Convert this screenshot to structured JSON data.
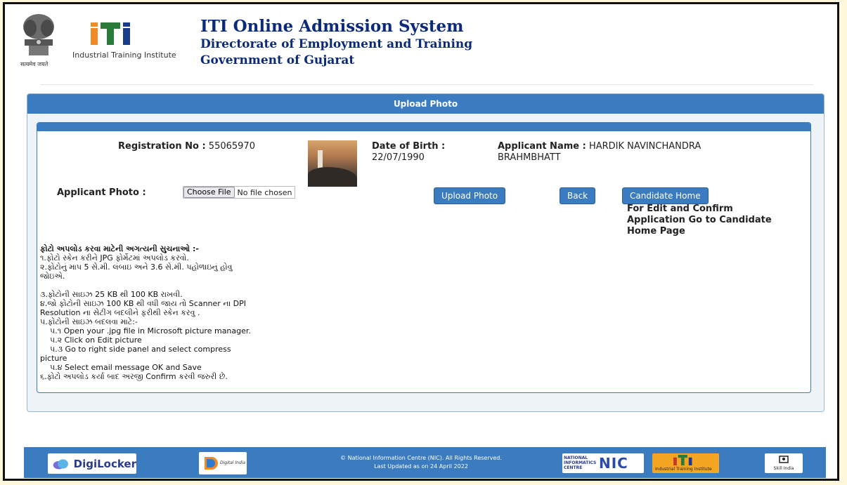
{
  "header": {
    "emblem_caption": "सत्यमेव जयते",
    "iti_logo_caption": "Industrial Training Institute",
    "title": "ITI Online Admission System",
    "line2": "Directorate of Employment and Training",
    "line3": "Government of Gujarat"
  },
  "panel": {
    "title": "Upload Photo"
  },
  "applicant": {
    "reg_label": "Registration No :",
    "reg_value": "55065970",
    "dob_label": "Date of Birth :",
    "dob_value": "22/07/1990",
    "name_label": "Applicant Name :",
    "name_value": "HARDIK NAVINCHANDRA",
    "name_value_2": "BRAHMBHATT",
    "photo_label": "Applicant Photo :"
  },
  "file_input": {
    "button_label": "Choose File",
    "status": "No file chosen"
  },
  "buttons": {
    "upload": "Upload Photo",
    "back": "Back",
    "candidate_home": "Candidate Home"
  },
  "candidate_note": [
    "For Edit and Confirm",
    "Application Go to Candidate",
    "Home Page"
  ],
  "instructions": {
    "heading": "ફોટો અપલોડ કરવા માટેની અગત્યની સુચનાઓ :-",
    "lines": [
      "૧.ફોટો સ્કેન કરીને JPG ફોર્મેટમાં અપલોડ કરવો.",
      "૨.ફોટોનું માપ 5 સે.મી. લંબાઇ અને 3.6 સે.મી. પહોળાઇનું હોવુ",
      "જોઇએ.",
      "",
      "૩.ફોટોની સાઇઝ 25 KB થી 100 KB રાખવી.",
      "૪.જો ફોટોની સાઇઝ 100 KB થી વધી જાય તો Scanner ના DPI",
      "Resolution ના સેટીંગ બદલીને ફરીથી સ્કેન કરવુ .",
      "૫.ફોટોની સાઇઝ બદલવા માટે:-",
      "   ૫.૧ Open your .jpg file in Microsoft picture manager.",
      "   ૫.૨ Click on Edit picture",
      "   ૫.૩ Go to right side panel and select compress",
      "picture",
      "   ૫.૪ Select email message OK and Save",
      "૬.ફોટો અપલોડ કર્યા બાદ અરજી Confirm કરવી જરુરી છે."
    ]
  },
  "footer": {
    "copyright": "© National Information Centre (NIC). All Rights Reserved.",
    "updated": "Last Updated as on 24 April 2022",
    "digilocker": "DigiLocker",
    "digital_india": "Digital India",
    "nic_text": "NATIONAL INFORMATICS CENTRE",
    "nic_big": "NIC",
    "iti_foot": "Industrial Training Institute",
    "skill": "Skill India"
  },
  "colors": {
    "primary": "#3b7bbf",
    "header_text": "#0b2a78"
  }
}
